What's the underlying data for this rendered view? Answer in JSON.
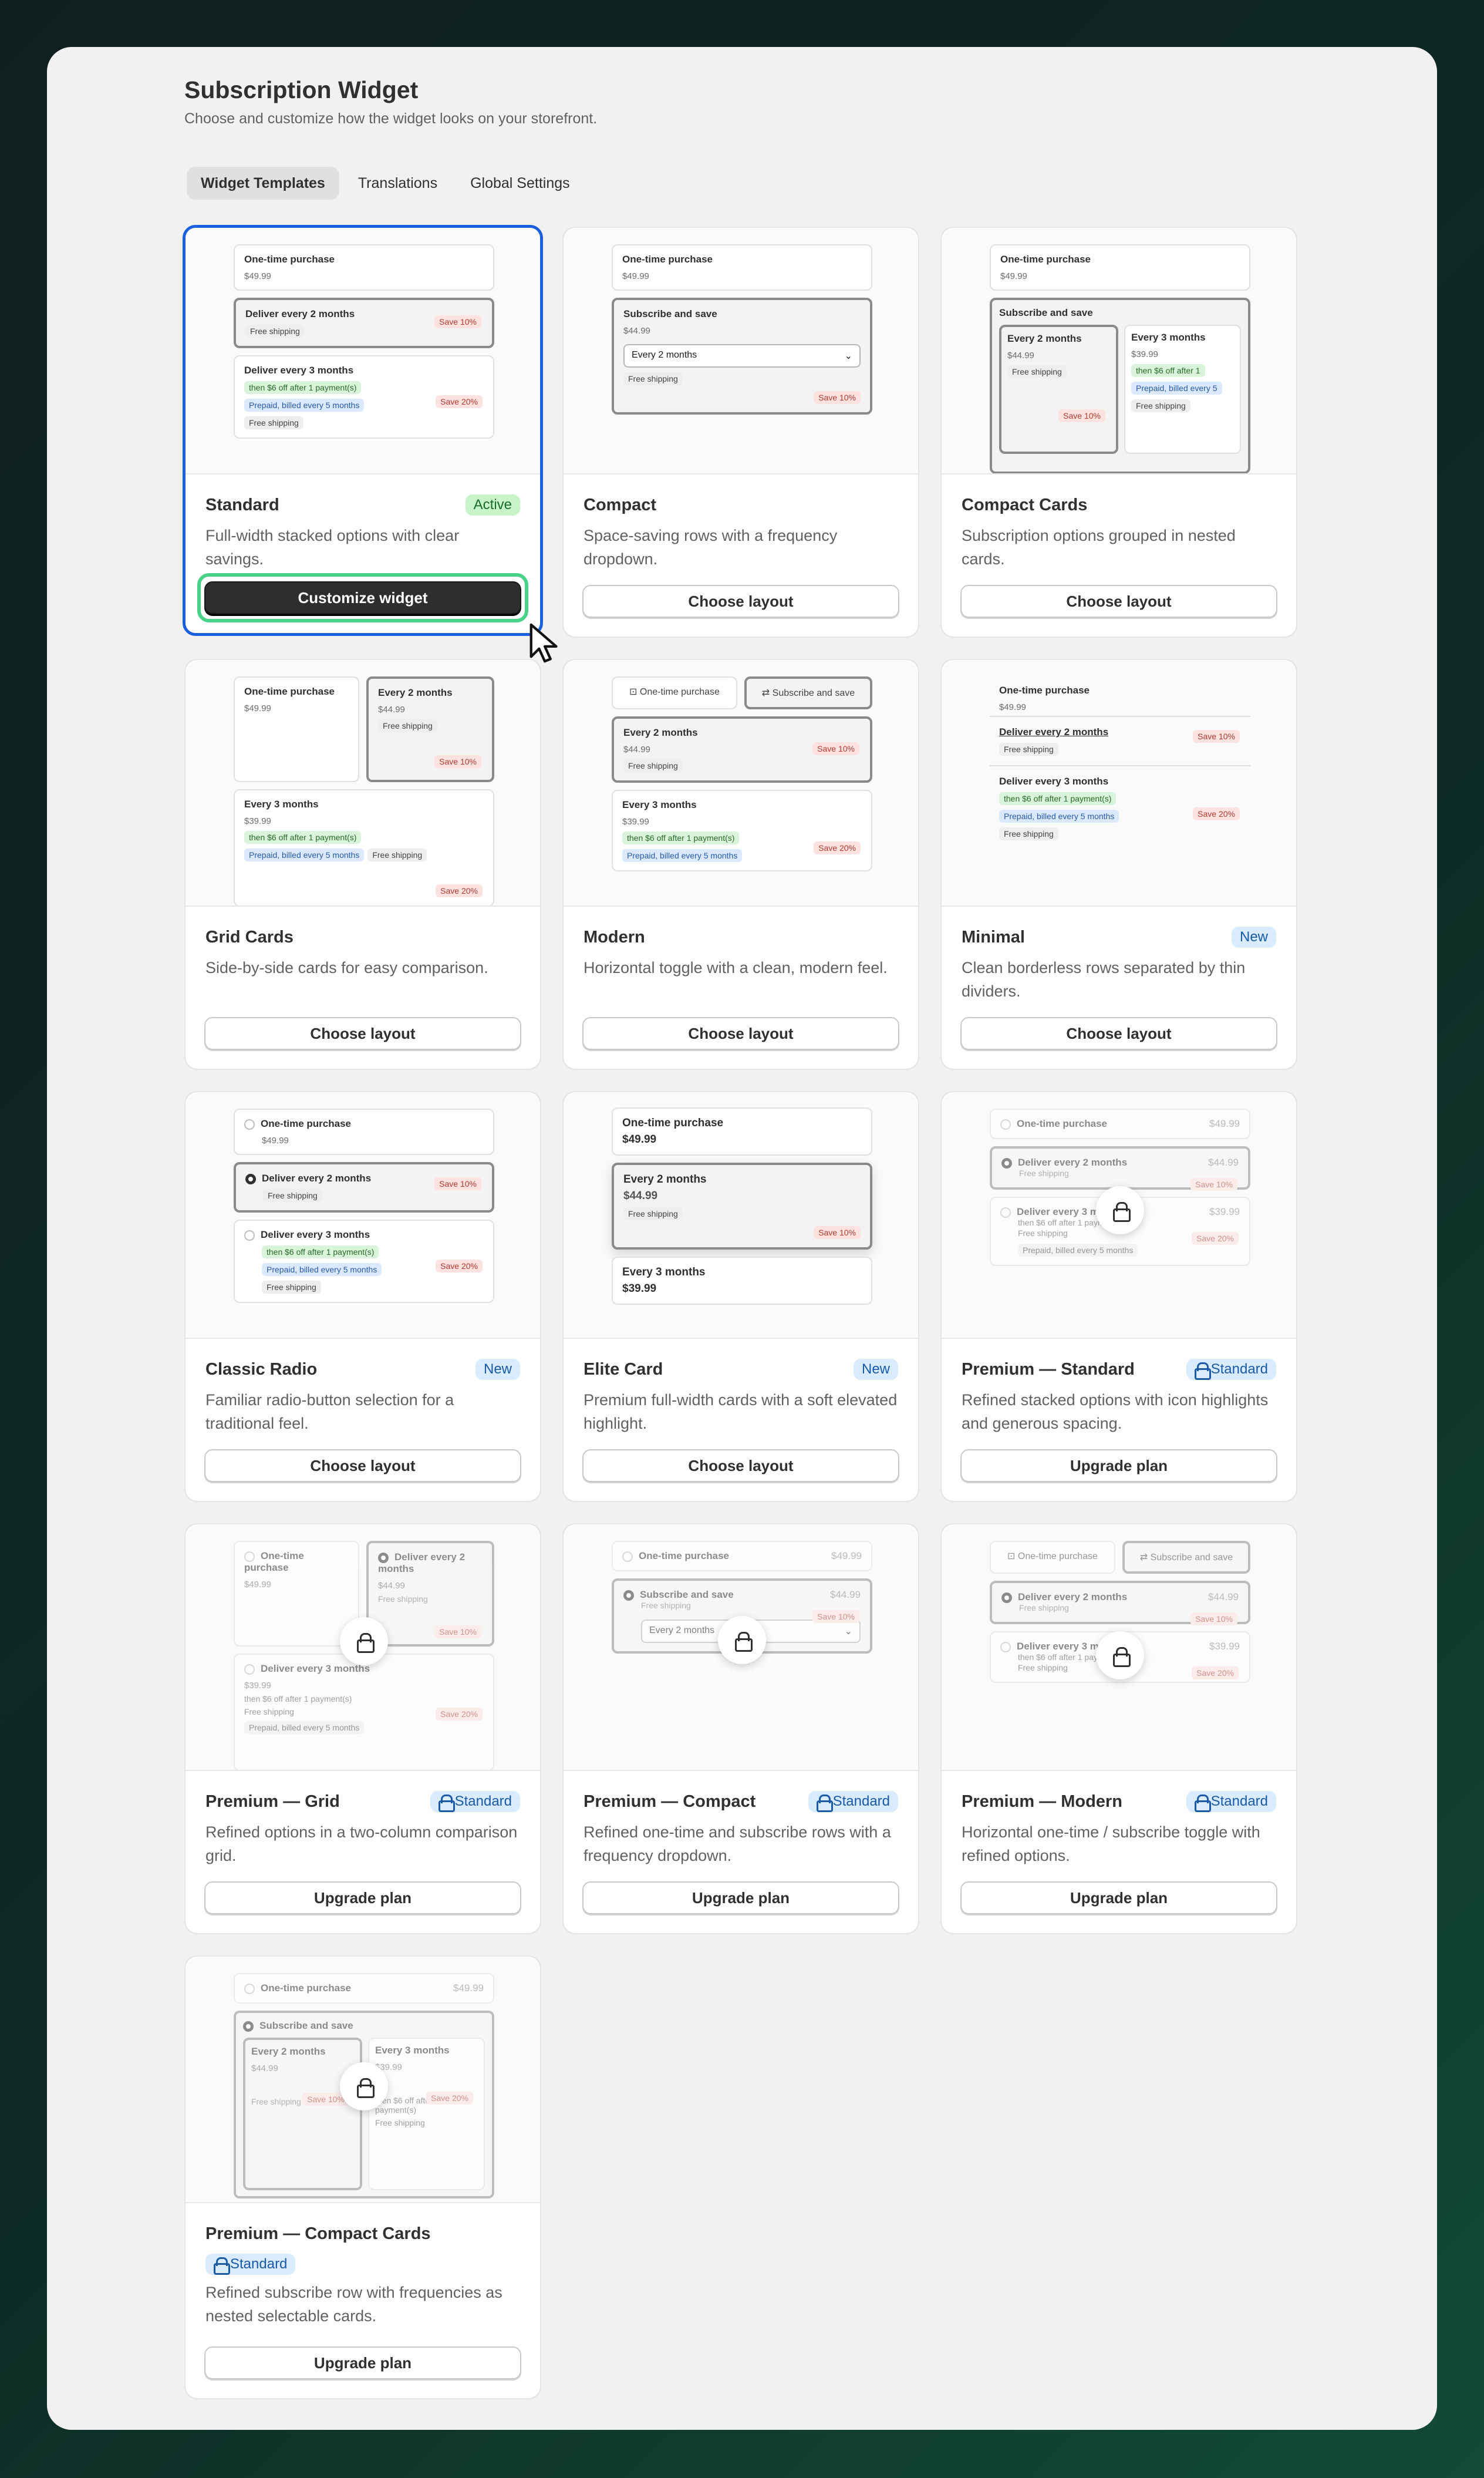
{
  "page": {
    "title": "Subscription Widget",
    "subtitle": "Choose and customize how the widget looks on your storefront."
  },
  "tabs": [
    {
      "label": "Widget Templates",
      "active": true
    },
    {
      "label": "Translations"
    },
    {
      "label": "Global Settings"
    }
  ],
  "templates": [
    {
      "name": "Standard",
      "badge": "Active",
      "desc": "Full-width stacked options with clear savings.",
      "button": "Customize widget"
    },
    {
      "name": "Compact",
      "desc": "Space-saving rows with a frequency dropdown.",
      "button": "Choose layout"
    },
    {
      "name": "Compact Cards",
      "desc": "Subscription options grouped in nested cards.",
      "button": "Choose layout"
    },
    {
      "name": "Grid Cards",
      "desc": "Side-by-side cards for easy comparison.",
      "button": "Choose layout"
    },
    {
      "name": "Modern",
      "desc": "Horizontal toggle with a clean, modern feel.",
      "button": "Choose layout"
    },
    {
      "name": "Minimal",
      "badge": "New",
      "desc": "Clean borderless rows separated by thin dividers.",
      "button": "Choose layout"
    },
    {
      "name": "Classic Radio",
      "badge": "New",
      "desc": "Familiar radio-button selection for a traditional feel.",
      "button": "Choose layout"
    },
    {
      "name": "Elite Card",
      "badge": "New",
      "desc": "Premium full-width cards with a soft elevated highlight.",
      "button": "Choose layout"
    },
    {
      "name": "Premium — Standard",
      "badge": "Standard",
      "desc": "Refined stacked options with icon highlights and generous spacing.",
      "button": "Upgrade plan"
    },
    {
      "name": "Premium — Grid",
      "badge": "Standard",
      "desc": "Refined options in a two-column comparison grid.",
      "button": "Upgrade plan"
    },
    {
      "name": "Premium — Compact",
      "badge": "Standard",
      "desc": "Refined one-time and subscribe rows with a frequency dropdown.",
      "button": "Upgrade plan"
    },
    {
      "name": "Premium — Modern",
      "badge": "Standard",
      "desc": "Horizontal one-time / subscribe toggle with refined options.",
      "button": "Upgrade plan"
    },
    {
      "name": "Premium — Compact Cards",
      "badge": "Standard",
      "desc": "Refined subscribe row with frequencies as nested selectable cards.",
      "button": "Upgrade plan"
    }
  ],
  "preview": {
    "one_time": "One-time purchase",
    "price_one": "$49.99",
    "every2": "Deliver every 2 months",
    "every3": "Deliver every 3 months",
    "e2": "Every 2 months",
    "e3": "Every 3 months",
    "price2": "$44.99",
    "price3": "$39.99",
    "free": "Free shipping",
    "save10": "Save 10%",
    "save20": "Save 20%",
    "then": "then $6 off after 1 payment(s)",
    "prepaid": "Prepaid, billed every 5 months",
    "subscribe": "Subscribe and save",
    "dropdown": "Every 2 months"
  },
  "colors": {
    "selected_border": "#1a5fdb",
    "cta_ring": "#49d38a",
    "active_badge": "#c7f5c9",
    "new_badge": "#d8ebff"
  }
}
